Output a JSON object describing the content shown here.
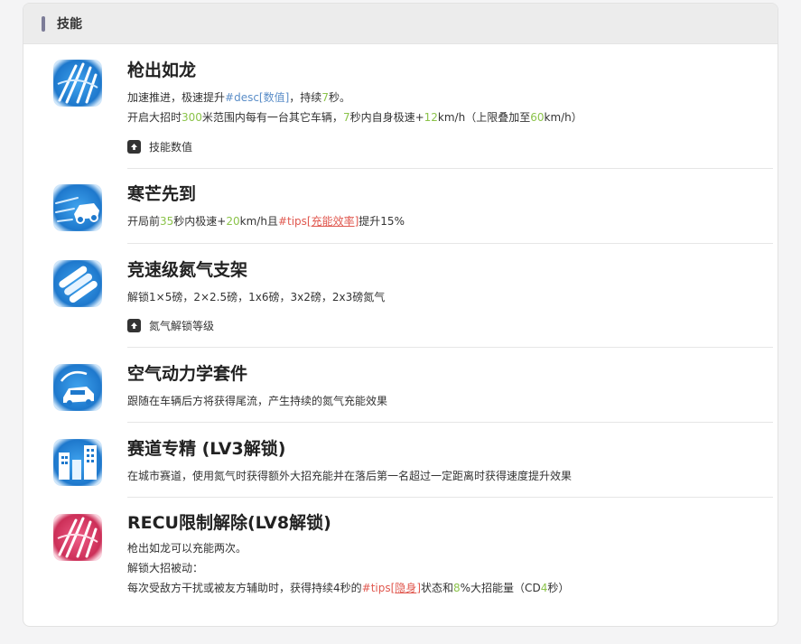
{
  "panel": {
    "title": "技能"
  },
  "skills": [
    {
      "icon": "speed-lines-icon",
      "title": "枪出如龙",
      "line1": [
        "加速推进，极速提升",
        "#desc[数值]",
        "，持续",
        "7",
        "秒。"
      ],
      "line2": [
        "开启大招时",
        "300",
        "米范围内每有一台其它车辆，",
        "7",
        "秒内自身极速+",
        "12",
        "km/h（上限叠加至",
        "60",
        "km/h）"
      ],
      "action": "技能数值"
    },
    {
      "icon": "fast-car-icon",
      "title": "寒芒先到",
      "line1": [
        "开局前",
        "35",
        "秒内极速+",
        "20",
        "km/h且",
        "#tips[",
        "充能效率",
        "]",
        "提升15%"
      ]
    },
    {
      "icon": "nitro-tanks-icon",
      "title": "竞速级氮气支架",
      "line1": [
        "解锁1×5磅，2×2.5磅，1x6磅，3x2磅，2x3磅氮气"
      ],
      "action": "氮气解锁等级"
    },
    {
      "icon": "aero-car-icon",
      "title": "空气动力学套件",
      "line1": [
        "跟随在车辆后方将获得尾流，产生持续的氮气充能效果"
      ]
    },
    {
      "icon": "city-buildings-icon",
      "title": "赛道专精 (LV3解锁)",
      "line1": [
        "在城市赛道，使用氮气时获得额外大招充能并在落后第一名超过一定距离时获得速度提升效果"
      ]
    },
    {
      "icon": "pink-speed-icon",
      "title": "RECU限制解除(LV8解锁)",
      "line1": [
        "枪出如龙可以充能两次。"
      ],
      "line2": [
        "解锁大招被动："
      ],
      "line3": [
        "每次受敌方干扰或被友方辅助时，获得持续4秒的",
        "#tips[",
        "隐身",
        "]",
        "状态和",
        "8",
        "%大招能量（CD",
        "4",
        "秒）"
      ]
    }
  ],
  "colors": {
    "green": "#8bc34a",
    "blue": "#5b8ec8",
    "red": "#e0584f",
    "icon_blue": "#1e88d8",
    "icon_pink": "#d8406a"
  }
}
